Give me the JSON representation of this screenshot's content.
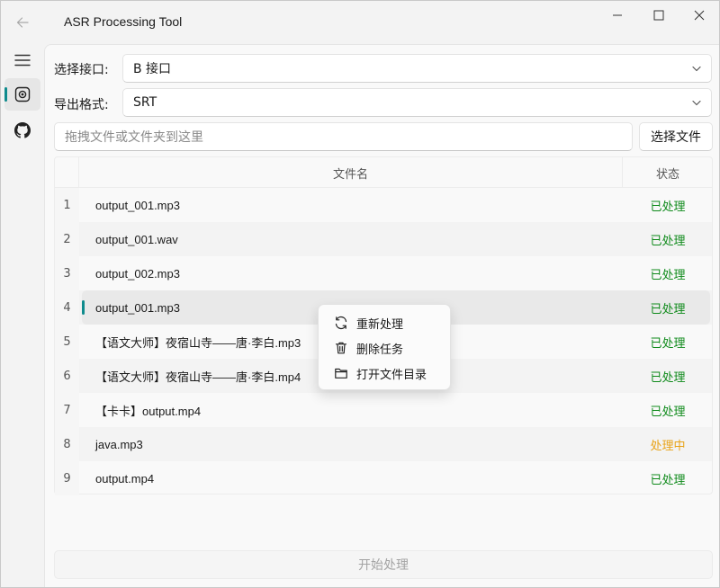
{
  "window": {
    "title": "ASR Processing Tool"
  },
  "nav": {
    "items": [
      {
        "icon": "hamburger-menu-icon"
      },
      {
        "icon": "asr-record-icon",
        "selected": true
      },
      {
        "icon": "github-icon"
      }
    ]
  },
  "form": {
    "interface_label": "选择接口:",
    "interface_value": "B 接口",
    "format_label": "导出格式:",
    "format_value": "SRT",
    "drop_placeholder": "拖拽文件或文件夹到这里",
    "choose_file_label": "选择文件"
  },
  "table": {
    "headers": {
      "name": "文件名",
      "status": "状态"
    },
    "rows": [
      {
        "index": "1",
        "name": "output_001.mp3",
        "status": "已处理"
      },
      {
        "index": "2",
        "name": "output_001.wav",
        "status": "已处理"
      },
      {
        "index": "3",
        "name": "output_002.mp3",
        "status": "已处理"
      },
      {
        "index": "4",
        "name": "output_001.mp3",
        "status": "已处理"
      },
      {
        "index": "5",
        "name": "【语文大师】夜宿山寺——唐·李白.mp3",
        "status": "已处理"
      },
      {
        "index": "6",
        "name": "【语文大师】夜宿山寺——唐·李白.mp4",
        "status": "已处理"
      },
      {
        "index": "7",
        "name": "【卡卡】output.mp4",
        "status": "已处理"
      },
      {
        "index": "8",
        "name": "java.mp3",
        "status": "处理中"
      },
      {
        "index": "9",
        "name": "output.mp4",
        "status": "已处理"
      }
    ],
    "status_colors": {
      "done": "#0e8a1a",
      "processing": "#e8a317"
    }
  },
  "context_menu": {
    "items": [
      {
        "label": "重新处理",
        "icon": "refresh-icon"
      },
      {
        "label": "删除任务",
        "icon": "trash-icon"
      },
      {
        "label": "打开文件目录",
        "icon": "folder-icon"
      }
    ]
  },
  "actions": {
    "start_label": "开始处理"
  },
  "theme": {
    "accent": "#0f8b8d"
  }
}
